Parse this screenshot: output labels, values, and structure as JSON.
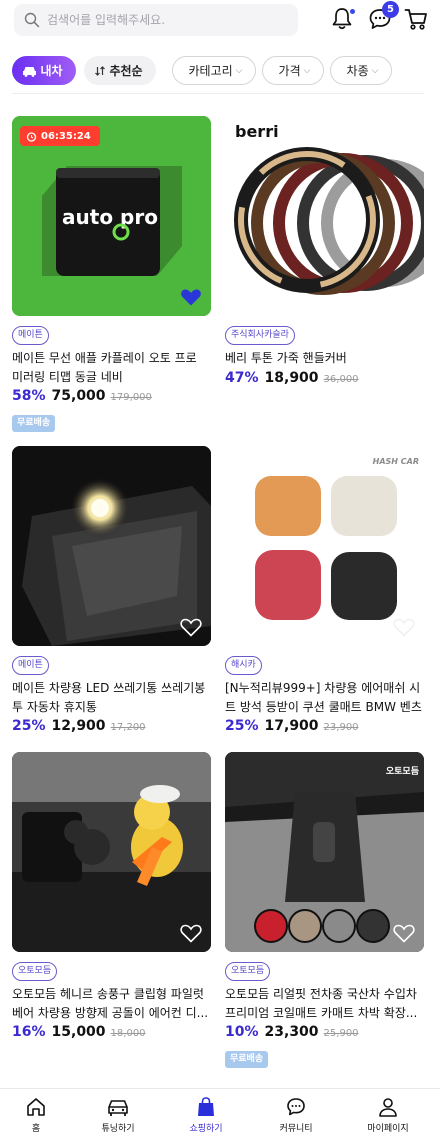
{
  "search": {
    "placeholder": "검색어를 입력해주세요."
  },
  "header": {
    "chat_badge": "5"
  },
  "filters": {
    "my_car": "내차",
    "sort": "추천순",
    "category": "카테고리",
    "price": "가격",
    "car_type": "차종"
  },
  "products": [
    {
      "tag": "메이튼",
      "timer": "06:35:24",
      "name": "메이튼 무선 애플 카플레이 오토 프로 미러링 티맵 동글 네비",
      "discount": "58%",
      "price": "75,000",
      "original": "179,000",
      "free_shipping": "무료배송",
      "thumb_text": "auto pro",
      "liked": true
    },
    {
      "tag": "주식회사카슬라",
      "name": "베리 투톤 가죽 핸들커버",
      "discount": "47%",
      "price": "18,900",
      "original": "36,000",
      "thumb_text": "berri",
      "liked": false
    },
    {
      "tag": "메이튼",
      "name": "메이튼 차량용 LED 쓰레기통 쓰레기봉투 자동차 휴지통",
      "discount": "25%",
      "price": "12,900",
      "original": "17,200",
      "liked": false
    },
    {
      "tag": "해시카",
      "name": "[N누적리뷰999+] 차량용 에어매쉬 시트 방석 등받이 쿠션 쿨매트 BMW 벤츠 ...",
      "discount": "25%",
      "price": "17,900",
      "original": "23,900",
      "thumb_text": "HASH CAR",
      "liked": false
    },
    {
      "tag": "오토모듬",
      "name": "오토모듬 헤니르 송풍구 클립형 파일럿 베어 차량용 방향제 공돌이 에어컨 디...",
      "discount": "16%",
      "price": "15,000",
      "original": "18,000",
      "liked": false
    },
    {
      "tag": "오토모듬",
      "name": "오토모듬 리얼핏 전차종 국산차 수입차 프리미엄 코일매트 카매트 차박 확장...",
      "discount": "10%",
      "price": "23,300",
      "original": "25,900",
      "free_shipping": "무료배송",
      "thumb_text": "오토모듬",
      "liked": false
    }
  ],
  "nav": [
    {
      "label": "홈",
      "icon": "home-icon"
    },
    {
      "label": "튜닝하기",
      "icon": "car-icon"
    },
    {
      "label": "쇼핑하기",
      "icon": "shopping-bag-icon",
      "active": true
    },
    {
      "label": "커뮤니티",
      "icon": "chat-icon"
    },
    {
      "label": "마이페이지",
      "icon": "person-icon"
    }
  ],
  "colors": {
    "accent": "#3b2ad0",
    "timer": "#ff3d2e",
    "free_shipping": "#a8c9ee"
  }
}
